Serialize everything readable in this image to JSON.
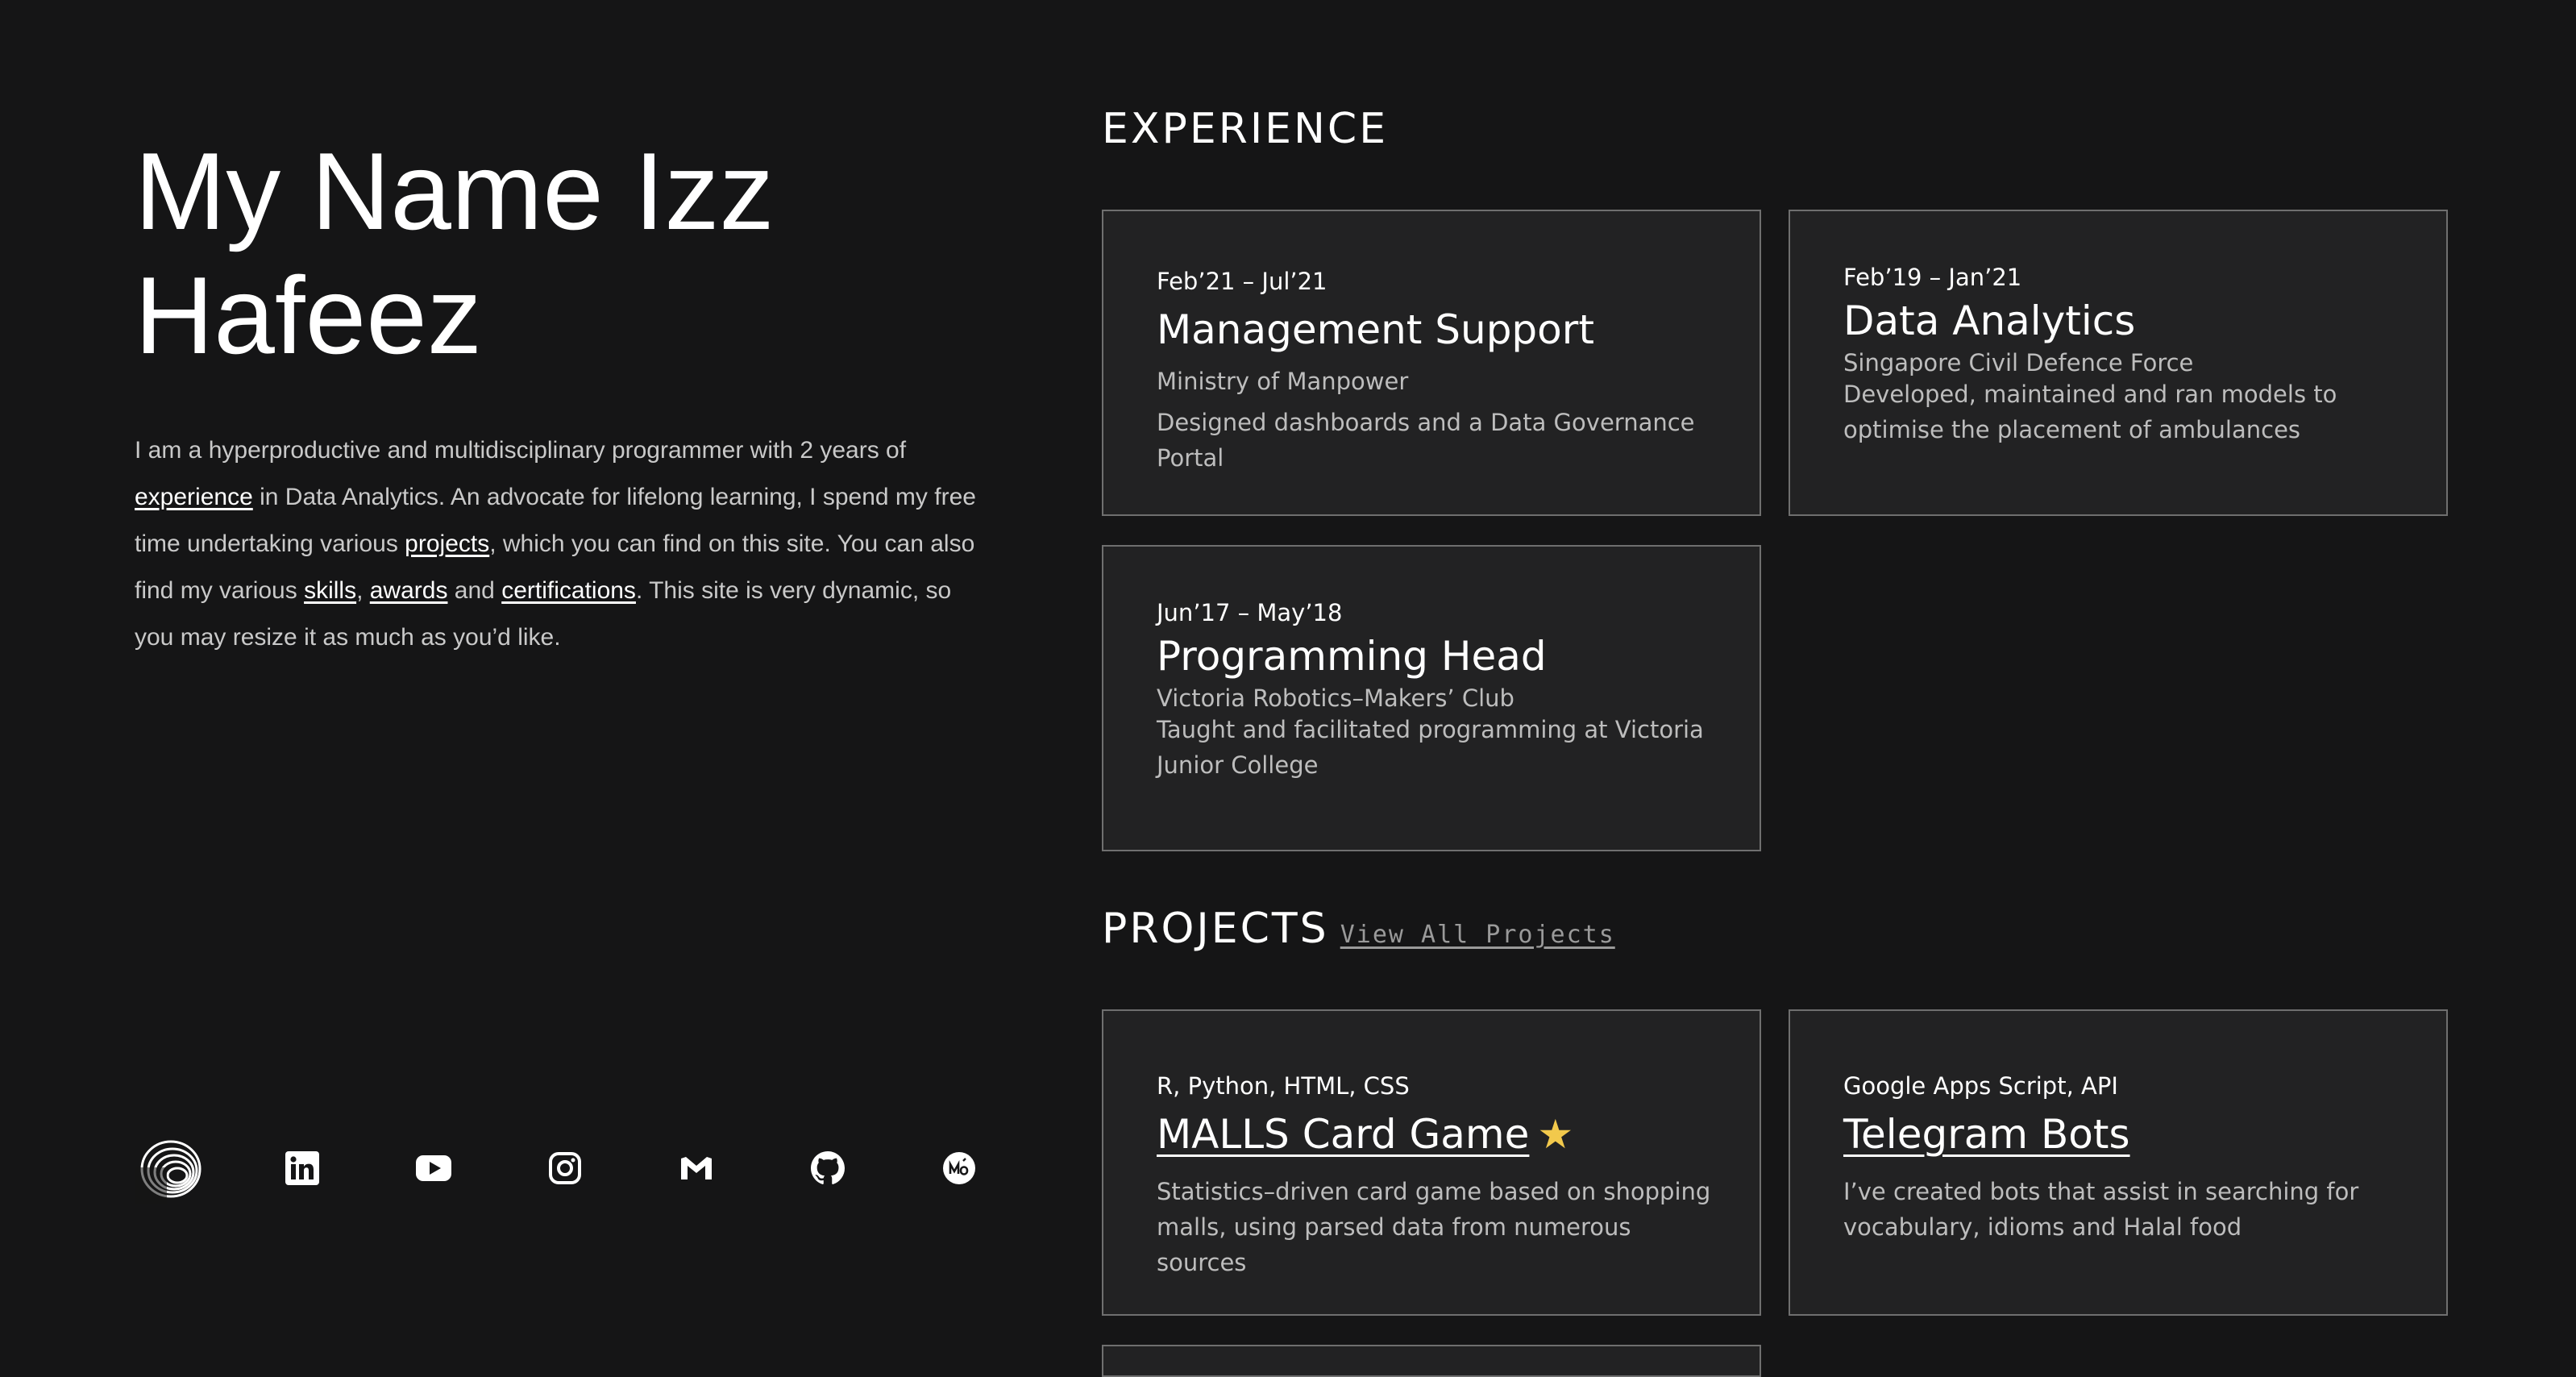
{
  "hero": {
    "title": "My Name Izz Hafeez"
  },
  "bio": {
    "t1": "I am a hyperproductive and multidisciplinary programmer with 2 years of ",
    "link_experience": "experience",
    "t2": " in Data Analytics. An advocate for lifelong learning, I spend my free time undertaking various ",
    "link_projects": "projects",
    "t3": ", which you can find on this site. You can also find my various ",
    "link_skills": "skills",
    "t4": ", ",
    "link_awards": "awards",
    "t5": " and ",
    "link_certifications": "certifications",
    "t6": ". This site is very dynamic, so you may resize it as much as you’d like."
  },
  "socials": [
    {
      "name": "logo"
    },
    {
      "name": "linkedin"
    },
    {
      "name": "youtube"
    },
    {
      "name": "instagram"
    },
    {
      "name": "gmail"
    },
    {
      "name": "github"
    },
    {
      "name": "medium"
    }
  ],
  "experience": {
    "heading": "EXPERIENCE",
    "items": [
      {
        "date": "Feb’21 – Jul’21",
        "title": "Management Support",
        "org": "Ministry of Manpower",
        "desc": "Designed dashboards and a Data Governance Portal"
      },
      {
        "date": "Feb’19 – Jan’21",
        "title": "Data Analytics",
        "org": "Singapore Civil Defence Force",
        "desc": "Developed, maintained and ran models to optimise the placement of ambulances"
      },
      {
        "date": "Jun’17 – May’18",
        "title": "Programming Head",
        "org": "Victoria Robotics–Makers’ Club",
        "desc": "Taught and facilitated programming at Victoria Junior College"
      }
    ]
  },
  "projects": {
    "heading": "PROJECTS",
    "view_all": "View All Projects",
    "items": [
      {
        "tags": "R, Python, HTML, CSS",
        "title": "MALLS Card Game",
        "star": "★",
        "desc": "Statistics–driven card game based on shopping malls, using parsed data from numerous sources"
      },
      {
        "tags": "Google Apps Script, API",
        "title": "Telegram Bots",
        "desc": "I’ve created bots that assist in searching for vocabulary, idioms and Halal food"
      }
    ]
  },
  "colors": {
    "background": "#151516",
    "card": "#222223",
    "border": "#6f6f6f",
    "star": "#f2c94c"
  }
}
